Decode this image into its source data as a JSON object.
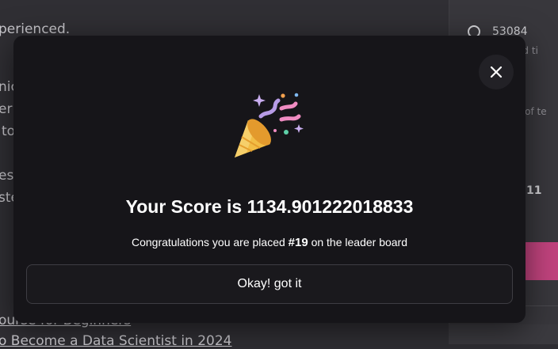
{
  "background": {
    "lines": [
      "perienced.",
      "nic",
      "er",
      "to",
      "ess",
      "ste"
    ],
    "links": [
      "ourse for Beginners",
      "o Become a Data Scientist in 2024"
    ],
    "sidebar": {
      "count": "53084",
      "sub1": "ered ti",
      "sub2": "er of te",
      "sub3": "11"
    }
  },
  "modal": {
    "score_prefix": "Your Score is ",
    "score_value": "1134.901222018833",
    "congrats_prefix": "Congratulations you are placed ",
    "rank": "#19",
    "congrats_suffix": " on the leader board",
    "ok_label": "Okay! got it",
    "party_icon": "party-popper-icon",
    "close_icon": "close-icon"
  }
}
